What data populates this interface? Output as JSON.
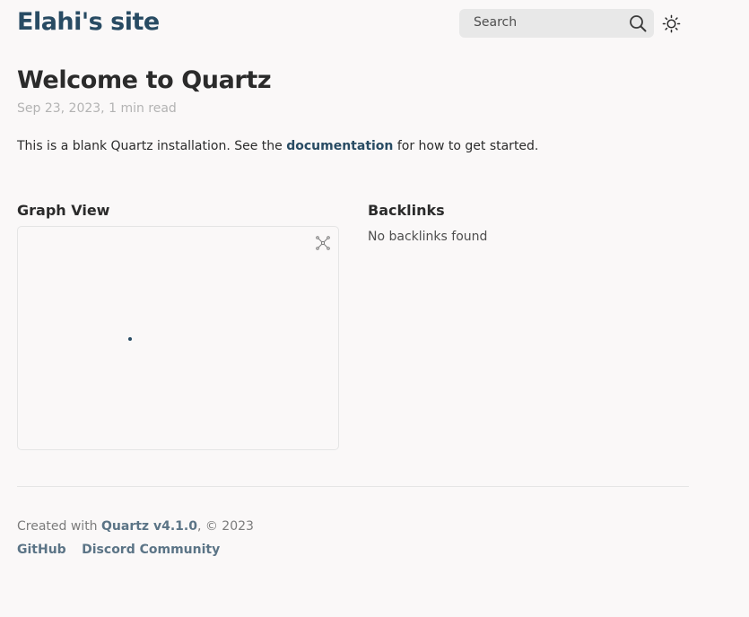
{
  "header": {
    "site_title": "Elahi's site",
    "search_placeholder": "Search",
    "search_icon": "search-icon",
    "darkmode_icon": "sun-icon"
  },
  "article": {
    "title": "Welcome to Quartz",
    "meta": "Sep 23, 2023, 1 min read",
    "paragraph_before": "This is a blank Quartz installation. See the ",
    "link_text": "documentation",
    "paragraph_after": " for how to get started."
  },
  "graph": {
    "heading": "Graph View",
    "expand_icon": "global-graph-icon",
    "node_color": "#284b63"
  },
  "backlinks": {
    "heading": "Backlinks",
    "empty_text": "No backlinks found"
  },
  "footer": {
    "created_prefix": "Created with ",
    "quartz_link": "Quartz v4.1.0",
    "created_suffix": ", © 2023",
    "links": [
      "GitHub",
      "Discord Community"
    ]
  },
  "colors": {
    "accent": "#284b63",
    "background": "#faf8f8",
    "text": "#2b2b2b",
    "muted": "#b3b3b3"
  }
}
